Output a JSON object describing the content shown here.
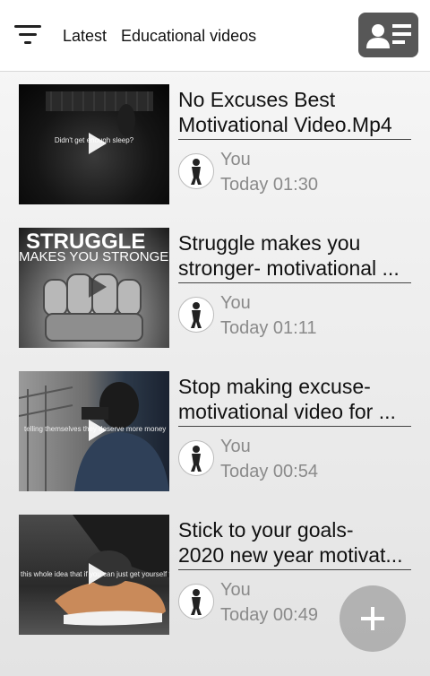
{
  "header": {
    "tabs": [
      {
        "label": "Latest"
      },
      {
        "label": "Educational videos"
      }
    ]
  },
  "videos": [
    {
      "title_line1": "No Excuses Best",
      "title_line2": "Motivational Video.Mp4",
      "thumb_caption": "Didn't get enough sleep?",
      "author": "You",
      "time": "Today 01:30"
    },
    {
      "title_line1": "Struggle makes you",
      "title_line2": "stronger- motivational ...",
      "thumb_big1": "STRUGGLE",
      "thumb_big2": "MAKES YOU STRONGER",
      "author": "You",
      "time": "Today 01:11"
    },
    {
      "title_line1": "Stop making excuse-",
      "title_line2": "motivational video for ...",
      "thumb_caption": "telling themselves they deserve more money",
      "author": "You",
      "time": "Today 00:54"
    },
    {
      "title_line1": "Stick to your goals-",
      "title_line2": "2020 new year motivat...",
      "thumb_caption": "this whole idea that if you can just get yourself to",
      "author": "You",
      "time": "Today 00:49"
    }
  ],
  "icons": {
    "menu": "menu-sort-icon",
    "profile": "contact-card-icon",
    "play": "play-icon",
    "fab": "plus-icon"
  }
}
